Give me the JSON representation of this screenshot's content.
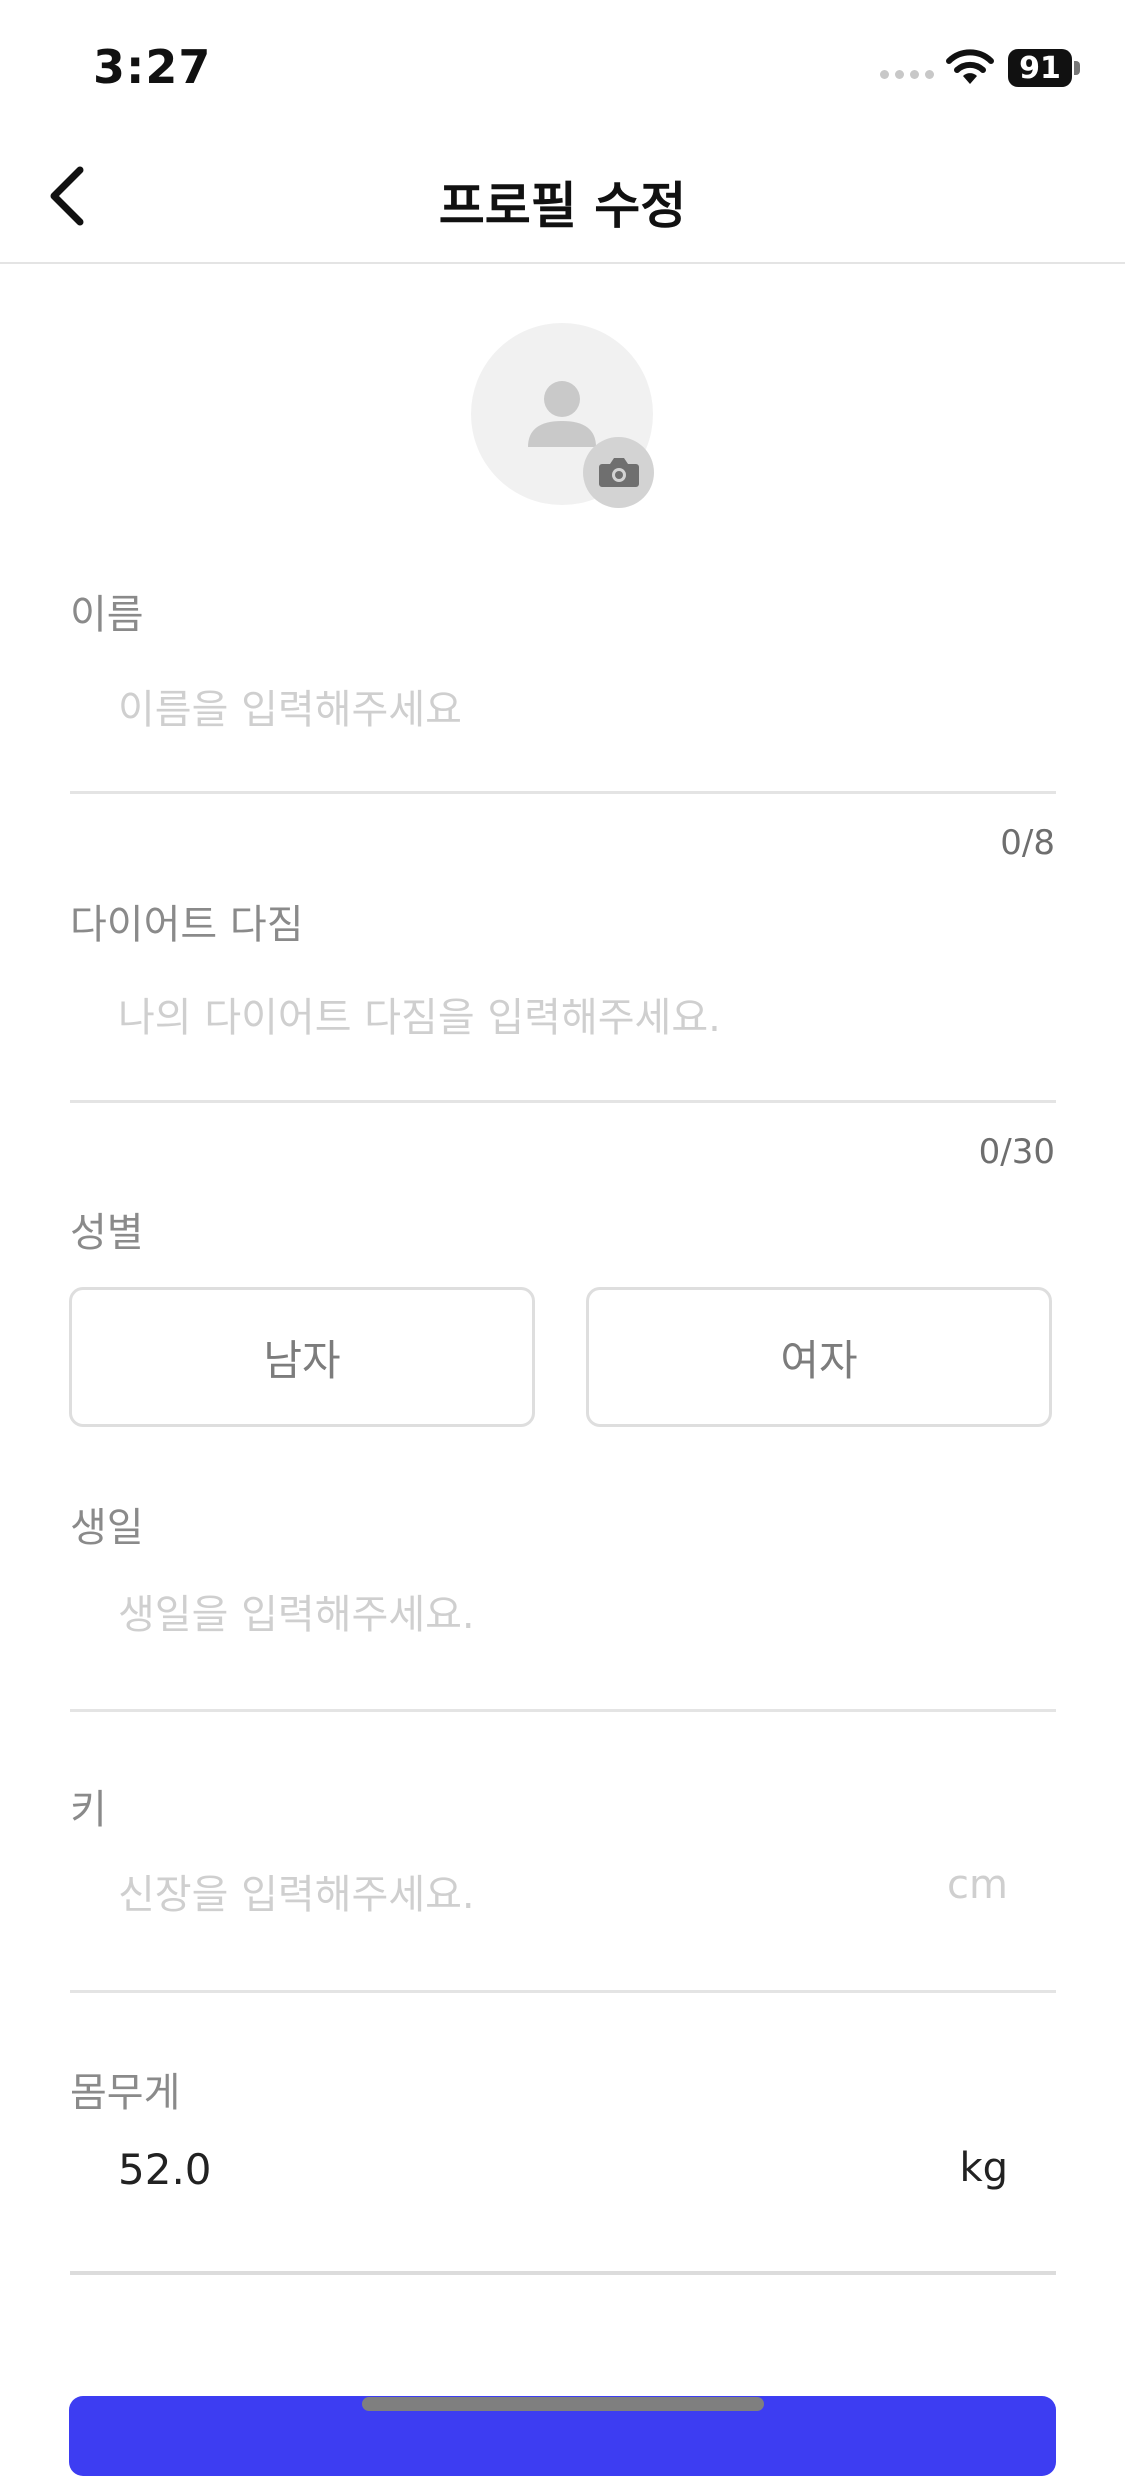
{
  "status_bar": {
    "time": "3:27",
    "battery": "91"
  },
  "header": {
    "title": "프로필 수정"
  },
  "fields": {
    "name": {
      "label": "이름",
      "placeholder": "이름을 입력해주세요",
      "counter": "0/8"
    },
    "resolution": {
      "label": "다이어트 다짐",
      "placeholder": "나의 다이어트 다짐을 입력해주세요.",
      "counter": "0/30"
    },
    "gender": {
      "label": "성별",
      "options": [
        "남자",
        "여자"
      ]
    },
    "birthday": {
      "label": "생일",
      "placeholder": "생일을 입력해주세요."
    },
    "height": {
      "label": "키",
      "placeholder": "신장을 입력해주세요.",
      "unit": "cm"
    },
    "weight": {
      "label": "몸무게",
      "value": "52.0",
      "unit": "kg"
    }
  },
  "colors": {
    "primary": "#3d3df2",
    "label": "#8a8a8a",
    "placeholder": "#cfcfcf",
    "divider": "#e4e4e4"
  },
  "icons": [
    "back-arrow-icon",
    "person-icon",
    "camera-icon",
    "wifi-icon"
  ]
}
